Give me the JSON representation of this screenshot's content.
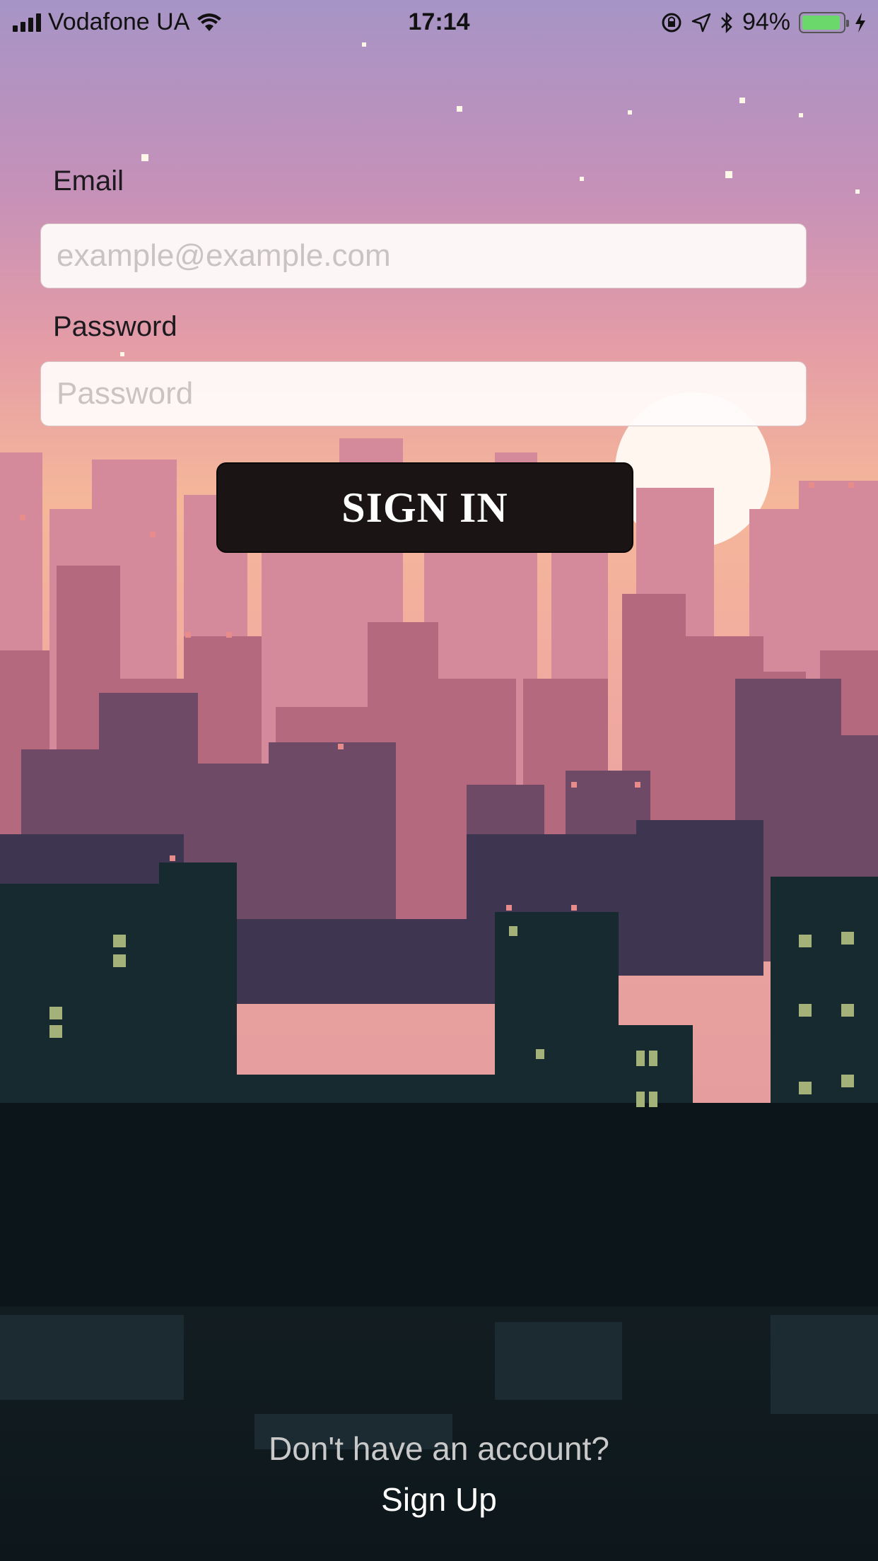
{
  "status_bar": {
    "carrier": "Vodafone UA",
    "time": "17:14",
    "battery": "94%",
    "battery_level": 0.94,
    "icons": [
      "signal-icon",
      "wifi-icon",
      "rotation-lock-icon",
      "location-icon",
      "bluetooth-icon",
      "battery-icon",
      "charging-icon"
    ]
  },
  "form": {
    "email_label": "Email",
    "email_placeholder": "example@example.com",
    "email_value": "",
    "password_label": "Password",
    "password_placeholder": "Password",
    "password_value": "",
    "signin_label": "SIGN IN"
  },
  "footer": {
    "question": "Don't have an account?",
    "signup_label": "Sign Up"
  },
  "colors": {
    "sky_top": "#a694c6",
    "sky_mid": "#d88fa1",
    "sky_horizon": "#f7b89a",
    "city_dark": "#0f1a1f",
    "button_bg": "#1a1414"
  },
  "background": "pixel-art-city-sunset"
}
